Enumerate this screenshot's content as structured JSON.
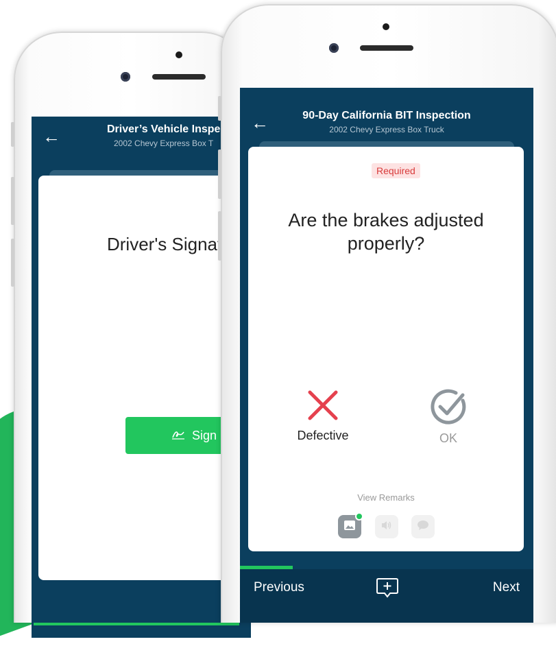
{
  "back_screen": {
    "nav": {
      "title": "Driver’s Vehicle Inspe",
      "subtitle": "2002 Chevy Express Box T"
    },
    "card": {
      "heading": "Driver's Signat",
      "sign_button": "Sign"
    },
    "progress": 1.0
  },
  "front_screen": {
    "nav": {
      "title": "90-Day California BIT Inspection",
      "subtitle": "2002 Chevy Express Box Truck"
    },
    "card": {
      "required_badge": "Required",
      "question": "Are the brakes adjusted properly?",
      "choices": [
        {
          "label": "Defective",
          "icon": "x-icon",
          "color": "#e5414e"
        },
        {
          "label": "OK",
          "icon": "check-circle-icon",
          "color": "#8e969c"
        }
      ],
      "view_remarks": "View Remarks",
      "remark_buttons": [
        "photo-icon",
        "audio-icon",
        "comment-icon"
      ]
    },
    "progress": 0.18,
    "bottom": {
      "previous": "Previous",
      "next": "Next"
    }
  },
  "colors": {
    "nav_bg": "#0b3f5e",
    "accent_green": "#22c65e",
    "danger_red": "#e5414e"
  }
}
